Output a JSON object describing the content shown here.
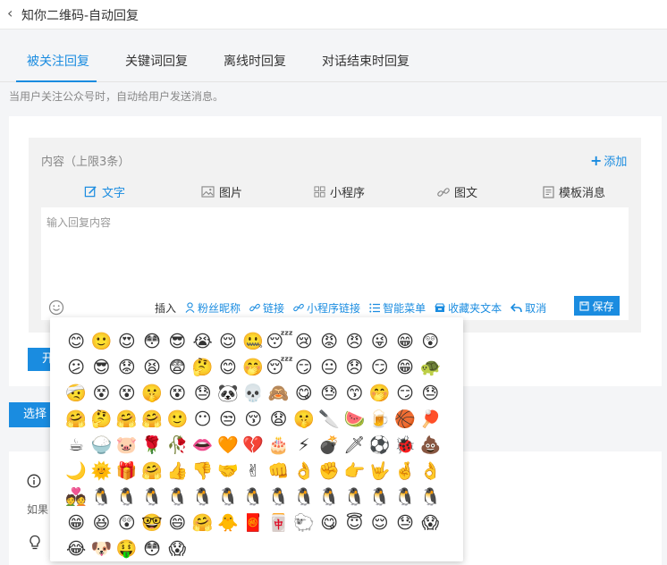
{
  "header": {
    "title": "知你二维码-自动回复"
  },
  "tabs": [
    {
      "label": "被关注回复"
    },
    {
      "label": "关键词回复"
    },
    {
      "label": "离线时回复"
    },
    {
      "label": "对话结束时回复"
    }
  ],
  "hint": "当用户关注公众号时，自动给用户发送消息。",
  "editor": {
    "content_label": "内容（上限3条）",
    "add_label": "添加",
    "types": [
      {
        "label": "文字",
        "icon": "edit-icon"
      },
      {
        "label": "图片",
        "icon": "image-icon"
      },
      {
        "label": "小程序",
        "icon": "grid-icon"
      },
      {
        "label": "图文",
        "icon": "link-icon"
      },
      {
        "label": "模板消息",
        "icon": "template-icon"
      }
    ],
    "placeholder": "输入回复内容",
    "toolbar": {
      "insert_label": "插入",
      "items": [
        {
          "label": "粉丝昵称",
          "icon": "user-icon"
        },
        {
          "label": "链接",
          "icon": "link-icon"
        },
        {
          "label": "小程序链接",
          "icon": "link-icon"
        },
        {
          "label": "智能菜单",
          "icon": "list-icon"
        },
        {
          "label": "收藏夹文本",
          "icon": "archive-icon"
        },
        {
          "label": "取消",
          "icon": "undo-icon"
        }
      ],
      "save_label": "保存"
    }
  },
  "buttons": {
    "open_label": "开",
    "select_label": "选择"
  },
  "bottom": {
    "info_text": "如果"
  },
  "emoji_panel": {
    "emojis": [
      "😊",
      "🙂",
      "😍",
      "😳",
      "😎",
      "😭",
      "😌",
      "🤐",
      "😴",
      "😢",
      "😡",
      "😠",
      "😜",
      "😁",
      "😲",
      "😕",
      "😎",
      "😟",
      "😫",
      "😨",
      "🤔",
      "😊",
      "🤭",
      "😴",
      "😏",
      "😐",
      "😞",
      "😏",
      "😁",
      "🐢",
      "🤕",
      "😵",
      "😵",
      "🤫",
      "😵",
      "😓",
      "🐼",
      "💀",
      "🙈",
      "😋",
      "😓",
      "😙",
      "🤭",
      "😏",
      "😓",
      "🤗",
      "🤔",
      "🤗",
      "🤗",
      "🙂",
      "😶",
      "😒",
      "😚",
      "😧",
      "🤫",
      "🔪",
      "🍉",
      "🍺",
      "🏀",
      "🏓",
      "☕",
      "🍚",
      "🐷",
      "🌹",
      "🥀",
      "👄",
      "🧡",
      "💔",
      "🎂",
      "⚡",
      "💣",
      "🗡",
      "⚽",
      "🐞",
      "💩",
      "🌙",
      "🌞",
      "🎁",
      "🤗",
      "👍",
      "👎",
      "🤝",
      "✌",
      "👊",
      "👌",
      "✊",
      "👉",
      "🤟",
      "🤞",
      "👌",
      "💑",
      "🐧",
      "🐧",
      "🐧",
      "🐧",
      "🐧",
      "🐧",
      "🐧",
      "🐧",
      "🐧",
      "🐧",
      "🐧",
      "🐧",
      "🐧",
      "🐧",
      "😁",
      "😆",
      "😲",
      "🤓",
      "😄",
      "🤗",
      "🐥",
      "🧧",
      "🀄",
      "🐑",
      "😋",
      "😇",
      "😌",
      "😓",
      "😱",
      "😂",
      "🐶",
      "🤑",
      "😳",
      "😱"
    ]
  }
}
